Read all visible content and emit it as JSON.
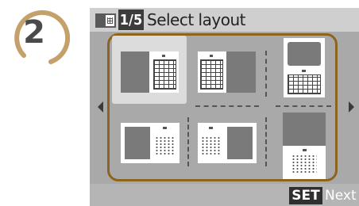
{
  "step": {
    "number": "2"
  },
  "header": {
    "page_counter": "1/5",
    "title": "Select layout",
    "layout_icon": "layout-icon"
  },
  "footer": {
    "set_key": "SET",
    "next_label": "Next"
  },
  "layouts": [
    {
      "position": "top-left",
      "selected": true
    },
    {
      "position": "top-middle",
      "selected": false
    },
    {
      "position": "top-right",
      "selected": false
    },
    {
      "position": "bottom-left",
      "selected": false
    },
    {
      "position": "bottom-middle",
      "selected": false
    },
    {
      "position": "bottom-right",
      "selected": false
    }
  ],
  "colors": {
    "selection_frame": "#8b6520",
    "screen_bg": "#a9a9a9",
    "title_bar": "#cfcfcf"
  }
}
